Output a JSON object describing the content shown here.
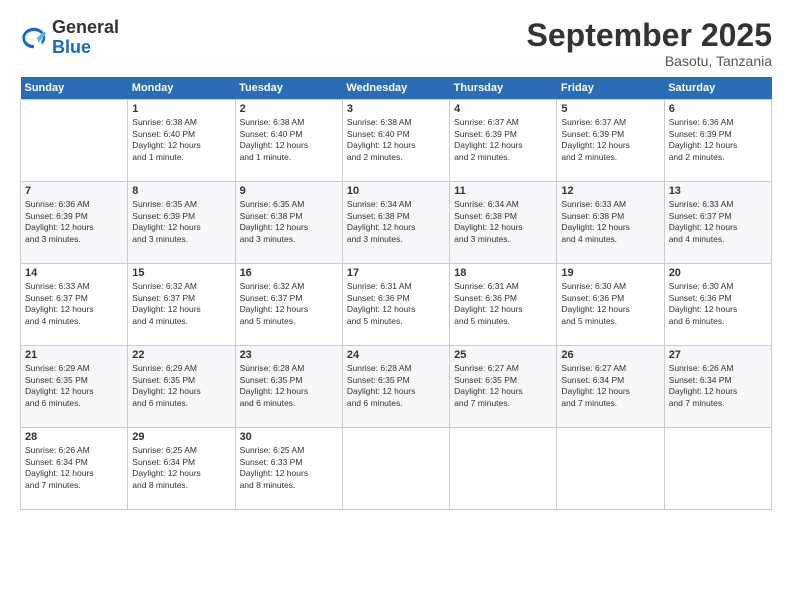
{
  "header": {
    "logo_general": "General",
    "logo_blue": "Blue",
    "month_title": "September 2025",
    "location": "Basotu, Tanzania"
  },
  "days_of_week": [
    "Sunday",
    "Monday",
    "Tuesday",
    "Wednesday",
    "Thursday",
    "Friday",
    "Saturday"
  ],
  "weeks": [
    [
      {
        "num": "",
        "info": ""
      },
      {
        "num": "1",
        "info": "Sunrise: 6:38 AM\nSunset: 6:40 PM\nDaylight: 12 hours\nand 1 minute."
      },
      {
        "num": "2",
        "info": "Sunrise: 6:38 AM\nSunset: 6:40 PM\nDaylight: 12 hours\nand 1 minute."
      },
      {
        "num": "3",
        "info": "Sunrise: 6:38 AM\nSunset: 6:40 PM\nDaylight: 12 hours\nand 2 minutes."
      },
      {
        "num": "4",
        "info": "Sunrise: 6:37 AM\nSunset: 6:39 PM\nDaylight: 12 hours\nand 2 minutes."
      },
      {
        "num": "5",
        "info": "Sunrise: 6:37 AM\nSunset: 6:39 PM\nDaylight: 12 hours\nand 2 minutes."
      },
      {
        "num": "6",
        "info": "Sunrise: 6:36 AM\nSunset: 6:39 PM\nDaylight: 12 hours\nand 2 minutes."
      }
    ],
    [
      {
        "num": "7",
        "info": "Sunrise: 6:36 AM\nSunset: 6:39 PM\nDaylight: 12 hours\nand 3 minutes."
      },
      {
        "num": "8",
        "info": "Sunrise: 6:35 AM\nSunset: 6:39 PM\nDaylight: 12 hours\nand 3 minutes."
      },
      {
        "num": "9",
        "info": "Sunrise: 6:35 AM\nSunset: 6:38 PM\nDaylight: 12 hours\nand 3 minutes."
      },
      {
        "num": "10",
        "info": "Sunrise: 6:34 AM\nSunset: 6:38 PM\nDaylight: 12 hours\nand 3 minutes."
      },
      {
        "num": "11",
        "info": "Sunrise: 6:34 AM\nSunset: 6:38 PM\nDaylight: 12 hours\nand 3 minutes."
      },
      {
        "num": "12",
        "info": "Sunrise: 6:33 AM\nSunset: 6:38 PM\nDaylight: 12 hours\nand 4 minutes."
      },
      {
        "num": "13",
        "info": "Sunrise: 6:33 AM\nSunset: 6:37 PM\nDaylight: 12 hours\nand 4 minutes."
      }
    ],
    [
      {
        "num": "14",
        "info": "Sunrise: 6:33 AM\nSunset: 6:37 PM\nDaylight: 12 hours\nand 4 minutes."
      },
      {
        "num": "15",
        "info": "Sunrise: 6:32 AM\nSunset: 6:37 PM\nDaylight: 12 hours\nand 4 minutes."
      },
      {
        "num": "16",
        "info": "Sunrise: 6:32 AM\nSunset: 6:37 PM\nDaylight: 12 hours\nand 5 minutes."
      },
      {
        "num": "17",
        "info": "Sunrise: 6:31 AM\nSunset: 6:36 PM\nDaylight: 12 hours\nand 5 minutes."
      },
      {
        "num": "18",
        "info": "Sunrise: 6:31 AM\nSunset: 6:36 PM\nDaylight: 12 hours\nand 5 minutes."
      },
      {
        "num": "19",
        "info": "Sunrise: 6:30 AM\nSunset: 6:36 PM\nDaylight: 12 hours\nand 5 minutes."
      },
      {
        "num": "20",
        "info": "Sunrise: 6:30 AM\nSunset: 6:36 PM\nDaylight: 12 hours\nand 6 minutes."
      }
    ],
    [
      {
        "num": "21",
        "info": "Sunrise: 6:29 AM\nSunset: 6:35 PM\nDaylight: 12 hours\nand 6 minutes."
      },
      {
        "num": "22",
        "info": "Sunrise: 6:29 AM\nSunset: 6:35 PM\nDaylight: 12 hours\nand 6 minutes."
      },
      {
        "num": "23",
        "info": "Sunrise: 6:28 AM\nSunset: 6:35 PM\nDaylight: 12 hours\nand 6 minutes."
      },
      {
        "num": "24",
        "info": "Sunrise: 6:28 AM\nSunset: 6:35 PM\nDaylight: 12 hours\nand 6 minutes."
      },
      {
        "num": "25",
        "info": "Sunrise: 6:27 AM\nSunset: 6:35 PM\nDaylight: 12 hours\nand 7 minutes."
      },
      {
        "num": "26",
        "info": "Sunrise: 6:27 AM\nSunset: 6:34 PM\nDaylight: 12 hours\nand 7 minutes."
      },
      {
        "num": "27",
        "info": "Sunrise: 6:26 AM\nSunset: 6:34 PM\nDaylight: 12 hours\nand 7 minutes."
      }
    ],
    [
      {
        "num": "28",
        "info": "Sunrise: 6:26 AM\nSunset: 6:34 PM\nDaylight: 12 hours\nand 7 minutes."
      },
      {
        "num": "29",
        "info": "Sunrise: 6:25 AM\nSunset: 6:34 PM\nDaylight: 12 hours\nand 8 minutes."
      },
      {
        "num": "30",
        "info": "Sunrise: 6:25 AM\nSunset: 6:33 PM\nDaylight: 12 hours\nand 8 minutes."
      },
      {
        "num": "",
        "info": ""
      },
      {
        "num": "",
        "info": ""
      },
      {
        "num": "",
        "info": ""
      },
      {
        "num": "",
        "info": ""
      }
    ]
  ]
}
